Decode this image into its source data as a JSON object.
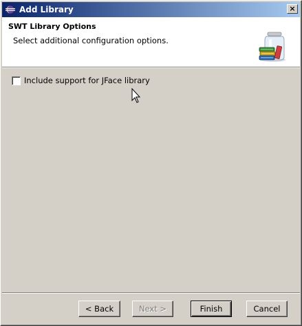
{
  "window": {
    "title": "Add Library",
    "close_label": "×"
  },
  "header": {
    "title": "SWT Library Options",
    "description": "Select additional configuration options."
  },
  "options": {
    "jface_label": "Include support for JFace library",
    "jface_checked": false
  },
  "buttons": {
    "back": "< Back",
    "next": "Next >",
    "finish": "Finish",
    "cancel": "Cancel"
  },
  "colors": {
    "titlebar_start": "#0a246a",
    "titlebar_end": "#a6caf0",
    "dialog_bg": "#d4d0c8"
  }
}
